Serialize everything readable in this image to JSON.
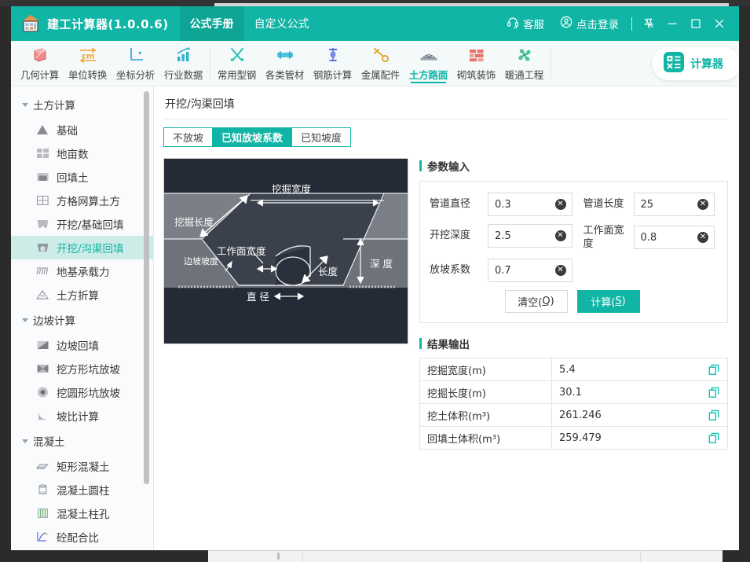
{
  "window": {
    "brand_title": "建工计算器(1.0.0.6)",
    "brand_icon": "house-calculator-icon",
    "top_tabs": [
      {
        "label": "公式手册",
        "active": true
      },
      {
        "label": "自定义公式",
        "active": false
      }
    ],
    "right_actions": [
      {
        "label": "客服",
        "icon": "headset-icon"
      },
      {
        "label": "点击登录",
        "icon": "user-circle-icon"
      }
    ],
    "controls": [
      {
        "name": "pin-icon"
      },
      {
        "name": "minimize-icon"
      },
      {
        "name": "maximize-icon"
      },
      {
        "name": "close-icon"
      }
    ]
  },
  "toolbar": {
    "items": [
      {
        "label": "几何计算",
        "icon": "cube-icon",
        "active": false
      },
      {
        "label": "单位转换",
        "icon": "cm-unit-icon",
        "active": false
      },
      {
        "label": "坐标分析",
        "icon": "axes-icon",
        "active": false
      },
      {
        "label": "行业数据",
        "icon": "bar-chart-icon",
        "active": false
      },
      {
        "label": "常用型钢",
        "icon": "tools-icon",
        "active": false
      },
      {
        "label": "各类管材",
        "icon": "pipe-icon",
        "active": false
      },
      {
        "label": "钢筋计算",
        "icon": "rebar-icon",
        "active": false
      },
      {
        "label": "金属配件",
        "icon": "wrench-icon",
        "active": false
      },
      {
        "label": "土方路面",
        "icon": "road-icon",
        "active": true
      },
      {
        "label": "砌筑装饰",
        "icon": "brick-icon",
        "active": false
      },
      {
        "label": "暖通工程",
        "icon": "fan-icon",
        "active": false
      }
    ],
    "calculator_pill": {
      "label": "计算器",
      "icon": "calculator-icon"
    }
  },
  "sidebar": {
    "groups": [
      {
        "label": "土方计算",
        "items": [
          {
            "label": "基础",
            "icon": "foundation-icon",
            "active": false
          },
          {
            "label": "地亩数",
            "icon": "grid-field-icon",
            "active": false
          },
          {
            "label": "回填土",
            "icon": "backfill-icon",
            "active": false
          },
          {
            "label": "方格网算土方",
            "icon": "square-grid-icon",
            "active": false
          },
          {
            "label": "开挖/基础回填",
            "icon": "excavation-icon",
            "active": false
          },
          {
            "label": "开挖/沟渠回填",
            "icon": "trench-icon",
            "active": true
          },
          {
            "label": "地基承载力",
            "icon": "bearing-capacity-icon",
            "active": false
          },
          {
            "label": "土方折算",
            "icon": "triangle-soil-icon",
            "active": false
          }
        ]
      },
      {
        "label": "边坡计算",
        "items": [
          {
            "label": "边坡回填",
            "icon": "slope-fill-icon",
            "active": false
          },
          {
            "label": "挖方形坑放坡",
            "icon": "square-pit-slope-icon",
            "active": false
          },
          {
            "label": "挖圆形坑放坡",
            "icon": "round-pit-slope-icon",
            "active": false
          },
          {
            "label": "坡比计算",
            "icon": "slope-ratio-icon",
            "active": false
          }
        ]
      },
      {
        "label": "混凝土",
        "items": [
          {
            "label": "矩形混凝土",
            "icon": "rect-concrete-icon",
            "active": false
          },
          {
            "label": "混凝土圆柱",
            "icon": "cylinder-concrete-icon",
            "active": false
          },
          {
            "label": "混凝土柱孔",
            "icon": "column-hole-icon",
            "active": false
          },
          {
            "label": "砼配合比",
            "icon": "mix-ratio-icon",
            "active": false
          }
        ]
      }
    ]
  },
  "main": {
    "page_title": "开挖/沟渠回填",
    "tabs": [
      {
        "label": "不放坡",
        "active": false
      },
      {
        "label": "已知放坡系数",
        "active": true
      },
      {
        "label": "已知坡度",
        "active": false
      }
    ],
    "diagram": {
      "name": "trench-cross-section-diagram",
      "labels": {
        "excavation_width": "挖掘宽度",
        "excavation_length": "挖掘长度",
        "working_face_width": "工作面宽度",
        "side_slope": "边坡坡度",
        "diameter": "直径",
        "length": "长度",
        "depth": "深  度"
      }
    },
    "params": {
      "section_title": "参数输入",
      "fields": [
        {
          "label": "管道直径",
          "value": "0.3"
        },
        {
          "label": "管道长度",
          "value": "25"
        },
        {
          "label": "开挖深度",
          "value": "2.5"
        },
        {
          "label": "工作面宽度",
          "value": "0.8"
        },
        {
          "label": "放坡系数",
          "value": "0.7"
        }
      ],
      "buttons": {
        "clear": "清空(Q)",
        "clear_text": "清空(",
        "clear_key": "Q",
        "clear_tail": ")",
        "calc_text": "计算(",
        "calc_key": "S",
        "calc_tail": ")"
      }
    },
    "results": {
      "section_title": "结果输出",
      "rows": [
        {
          "label": "挖掘宽度(m)",
          "value": "5.4"
        },
        {
          "label": "挖掘长度(m)",
          "value": "30.1"
        },
        {
          "label": "挖土体积(m³)",
          "value": "261.246"
        },
        {
          "label": "回填土体积(m³)",
          "value": "259.479"
        }
      ],
      "copy_icon": "copy-icon"
    }
  },
  "colors": {
    "brand_teal": "#11b5a5",
    "brand_teal_dark": "#0fa596",
    "active_sidebar_bg": "#cdece8",
    "diagram_dark": "#242a36",
    "diagram_gray": "#7b7f87"
  }
}
